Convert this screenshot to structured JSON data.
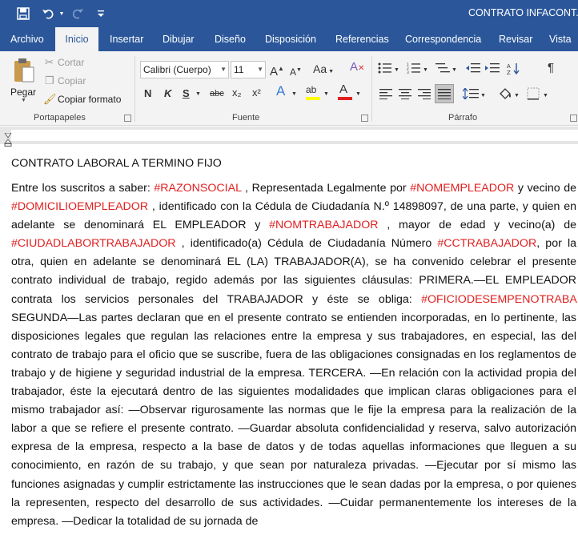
{
  "window": {
    "title": "CONTRATO INFACONT.do"
  },
  "quick_access": {
    "save": "save-icon",
    "undo": "undo-icon",
    "redo": "redo-icon",
    "customize": "customize-icon"
  },
  "tabs": [
    "Archivo",
    "Inicio",
    "Insertar",
    "Dibujar",
    "Diseño",
    "Disposición",
    "Referencias",
    "Correspondencia",
    "Revisar",
    "Vista"
  ],
  "active_tab": "Inicio",
  "clipboard": {
    "paste": "Pegar",
    "cut": "Cortar",
    "copy": "Copiar",
    "format_painter": "Copiar formato",
    "group_label": "Portapapeles"
  },
  "font": {
    "family": "Calibri (Cuerpo)",
    "size": "11",
    "grow": "A",
    "shrink": "A",
    "case": "Aa",
    "bold": "N",
    "italic": "K",
    "underline": "S",
    "strike": "abc",
    "subscript": "x₂",
    "superscript": "x²",
    "effects": "A",
    "highlight_letter": "ab",
    "color_letter": "A",
    "group_label": "Fuente",
    "highlight_color": "#ffff00",
    "font_color": "#e02020"
  },
  "paragraph": {
    "group_label": "Párrafo",
    "pilcrow": "¶"
  },
  "document": {
    "heading": "CONTRATO LABORAL A TERMINO FIJO",
    "segments": [
      {
        "t": "Entre los suscritos a saber: "
      },
      {
        "t": "#RAZONSOCIAL",
        "ph": true
      },
      {
        "t": " , Representada Legalmente por "
      },
      {
        "t": "#NOMEMPLEADOR",
        "ph": true
      },
      {
        "t": " y vecino de "
      },
      {
        "t": "#DOMICILIOEMPLEADOR",
        "ph": true
      },
      {
        "t": " , identificado con la Cédula de Ciudadanía N.º 14898097, de una parte, y quien en adelante se denominará EL EMPLEADOR y "
      },
      {
        "t": "#NOMTRABAJADOR",
        "ph": true
      },
      {
        "t": " , mayor de edad y vecino(a) de "
      },
      {
        "t": "#CIUDADLABORTRABAJADOR",
        "ph": true
      },
      {
        "t": " , identificado(a) Cédula de Ciudadanía Número "
      },
      {
        "t": "#CCTRABAJADOR",
        "ph": true
      },
      {
        "t": ", por la otra, quien en adelante se denominará EL (LA) TRABAJADOR(A), se ha convenido celebrar el presente contrato individual de trabajo, regido además por las siguientes cláusulas: PRIMERA.—EL EMPLEADOR contrata los servicios personales del TRABAJADOR y éste se obliga: "
      },
      {
        "t": "#OFICIODESEMPENOTRABA",
        "ph": true
      },
      {
        "t": " SEGUNDA—Las partes declaran que en el presente contrato se entienden incorporadas, en lo pertinente, las disposiciones legales que regulan las relaciones entre la empresa y sus trabajadores, en especial, las del contrato de trabajo para el oficio que se suscribe, fuera de las obligaciones consignadas en los reglamentos de trabajo y de higiene y seguridad industrial de la empresa. TERCERA. —En relación con la actividad propia del trabajador, éste la ejecutará dentro de las siguientes modalidades que implican claras obligaciones para el mismo trabajador así: —Observar rigurosamente las normas que le fije la empresa para la realización de la labor a que se refiere el presente contrato. —Guardar absoluta confidencialidad y reserva, salvo autorización expresa de la empresa, respecto a la base de datos y de todas aquellas informaciones que lleguen a su conocimiento, en razón de su trabajo, y que sean por naturaleza privadas. —Ejecutar por sí mismo las funciones asignadas y cumplir estrictamente las instrucciones que le sean dadas por la empresa, o por quienes la representen, respecto del desarrollo de sus actividades. —Cuidar permanentemente los intereses de la empresa. —Dedicar la totalidad de su jornada de"
      }
    ]
  }
}
